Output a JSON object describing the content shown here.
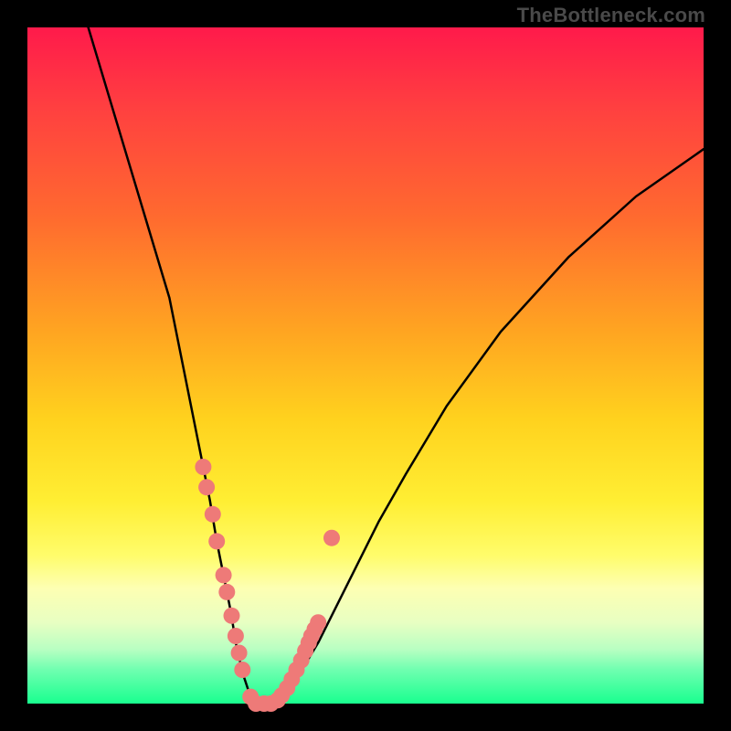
{
  "watermark": "TheBottleneck.com",
  "chart_data": {
    "type": "line",
    "title": "",
    "xlabel": "",
    "ylabel": "",
    "xlim": [
      0,
      100
    ],
    "ylim": [
      0,
      100
    ],
    "series": [
      {
        "name": "curve",
        "x": [
          9,
          12,
          15,
          18,
          21,
          23,
          24,
          25,
          26,
          27,
          28,
          29,
          30,
          31,
          32,
          33,
          34,
          35,
          36,
          37,
          38,
          40,
          43,
          45,
          48,
          52,
          56,
          62,
          70,
          80,
          90,
          100
        ],
        "values": [
          100,
          90,
          80,
          70,
          60,
          50,
          45,
          40,
          35,
          30,
          24,
          19,
          14,
          8,
          4,
          1,
          0,
          0,
          0,
          0.5,
          1.5,
          4,
          9,
          13,
          19,
          27,
          34,
          44,
          55,
          66,
          75,
          82
        ]
      }
    ],
    "markers": {
      "name": "data-points",
      "color": "#ee7a78",
      "radius_px": 9,
      "x": [
        26.0,
        26.5,
        27.4,
        28.0,
        29.0,
        29.5,
        30.2,
        30.8,
        31.3,
        31.8,
        33.0,
        33.8,
        35.0,
        36.0,
        37.0,
        37.6,
        38.4,
        39.1,
        39.8,
        40.5,
        41.1,
        41.6,
        42.0,
        42.5,
        43.0,
        45.0
      ],
      "values": [
        35.0,
        32.0,
        28.0,
        24.0,
        19.0,
        16.5,
        13.0,
        10.0,
        7.5,
        5.0,
        1.0,
        0.0,
        0.0,
        0.0,
        0.5,
        1.2,
        2.3,
        3.6,
        5.0,
        6.4,
        7.8,
        9.0,
        10.0,
        11.0,
        12.0,
        24.5
      ]
    }
  }
}
